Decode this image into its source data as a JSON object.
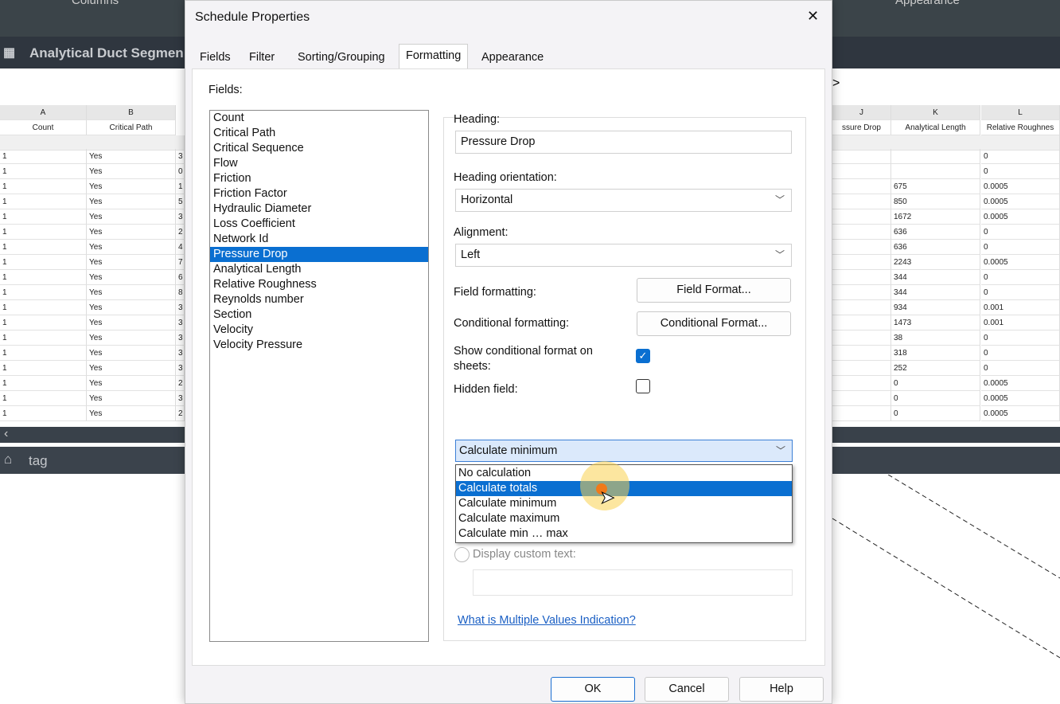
{
  "background": {
    "top_tabs": [
      "Columns",
      "Appearance"
    ],
    "schedule_title": "Analytical Duct Segmen",
    "nav_arrow": ">",
    "left_columns": [
      {
        "letter": "A",
        "name": "Count"
      },
      {
        "letter": "B",
        "name": "Critical Path"
      }
    ],
    "right_columns": [
      {
        "letter": "J",
        "name": "ssure Drop"
      },
      {
        "letter": "K",
        "name": "Analytical Length"
      },
      {
        "letter": "L",
        "name": "Relative Roughnes"
      }
    ],
    "rows": {
      "count": [
        "1",
        "1",
        "1",
        "1",
        "1",
        "1",
        "1",
        "1",
        "1",
        "1",
        "1",
        "1",
        "1",
        "1",
        "1",
        "1",
        "1",
        "1"
      ],
      "critical_path": [
        "Yes",
        "Yes",
        "Yes",
        "Yes",
        "Yes",
        "Yes",
        "Yes",
        "Yes",
        "Yes",
        "Yes",
        "Yes",
        "Yes",
        "Yes",
        "Yes",
        "Yes",
        "Yes",
        "Yes",
        "Yes"
      ],
      "col_c_partial": [
        "3",
        "0",
        "1",
        "5",
        "3",
        "2",
        "4",
        "7",
        "6",
        "8",
        "3",
        "3",
        "3",
        "3",
        "3",
        "2",
        "3",
        "2"
      ],
      "analytical_length": [
        "",
        "",
        "675",
        "850",
        "1672",
        "636",
        "636",
        "2243",
        "344",
        "344",
        "934",
        "1473",
        "38",
        "318",
        "252",
        "0",
        "0",
        "0"
      ],
      "relative_roughness": [
        "0",
        "0",
        "0.0005",
        "0.0005",
        "0.0005",
        "0",
        "0",
        "0.0005",
        "0",
        "0",
        "0.001",
        "0.001",
        "0",
        "0",
        "0",
        "0.0005",
        "0.0005",
        "0.0005"
      ]
    },
    "view_tab": "tag"
  },
  "dialog": {
    "title": "Schedule Properties",
    "close": "✕",
    "tabs": [
      "Fields",
      "Filter",
      "Sorting/Grouping",
      "Formatting",
      "Appearance"
    ],
    "active_tab": "Formatting",
    "fields_label": "Fields:",
    "fields": [
      "Count",
      "Critical Path",
      "Critical Sequence",
      "Flow",
      "Friction",
      "Friction Factor",
      "Hydraulic Diameter",
      "Loss Coefficient",
      "Network Id",
      "Pressure Drop",
      "Analytical Length",
      "Relative Roughness",
      "Reynolds number",
      "Section",
      "Velocity",
      "Velocity Pressure"
    ],
    "selected_field": "Pressure Drop",
    "heading_label": "Heading:",
    "heading_value": "Pressure Drop",
    "orientation_label": "Heading orientation:",
    "orientation_value": "Horizontal",
    "alignment_label": "Alignment:",
    "alignment_value": "Left",
    "field_formatting_label": "Field formatting:",
    "field_format_button": "Field Format...",
    "conditional_formatting_label": "Conditional formatting:",
    "conditional_format_button": "Conditional Format...",
    "show_conditional_label": "Show conditional format on sheets:",
    "show_conditional_checked": true,
    "hidden_field_label": "Hidden field:",
    "hidden_field_checked": false,
    "calc_value": "Calculate minimum",
    "calc_options": [
      "No calculation",
      "Calculate totals",
      "Calculate minimum",
      "Calculate maximum",
      "Calculate min … max"
    ],
    "calc_highlighted": "Calculate totals",
    "custom_text_label": "Display custom text:",
    "custom_text_value": "",
    "help_link": "What is Multiple Values Indication?",
    "ok": "OK",
    "cancel": "Cancel",
    "help": "Help",
    "accent": "#0a6fd1"
  }
}
